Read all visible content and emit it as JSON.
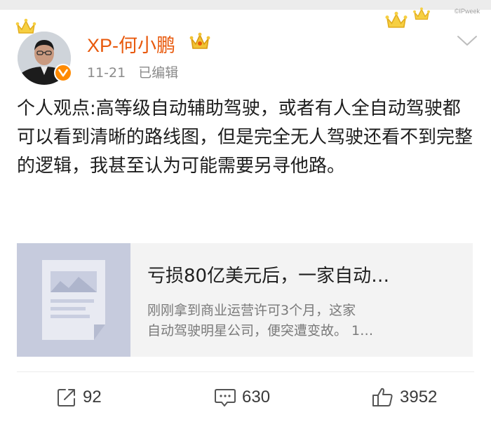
{
  "header": {
    "watermark": "©IPweek"
  },
  "post": {
    "author": {
      "name": "XP-何小鹏",
      "verified_badge_icon": "verified-v-icon",
      "member_icon": "crown-icon"
    },
    "date": "11-21",
    "edit_status": "已编辑",
    "text": "个人观点:高等级自动辅助驾驶，或者有人全自动驾驶都可以看到清晰的路线图，但是完全无人驾驶还看不到完整的逻辑，我甚至认为可能需要另寻他路。",
    "more_icon": "chevron-down-icon"
  },
  "link_card": {
    "title": "亏损80亿美元后，一家自动…",
    "description_lines": [
      "刚刚拿到商业运营许可3个月，这家",
      "自动驾驶明星公司，便突遭变故。 1…"
    ],
    "thumbnail_icon": "article-placeholder-icon"
  },
  "actions": {
    "repost": {
      "icon": "share-icon",
      "count": "92"
    },
    "comment": {
      "icon": "comment-icon",
      "count": "630"
    },
    "like": {
      "icon": "thumbs-up-icon",
      "count": "3952"
    }
  },
  "colors": {
    "username": "#e8590c",
    "badge": "#ff8a00",
    "crown": "#f2c335"
  }
}
